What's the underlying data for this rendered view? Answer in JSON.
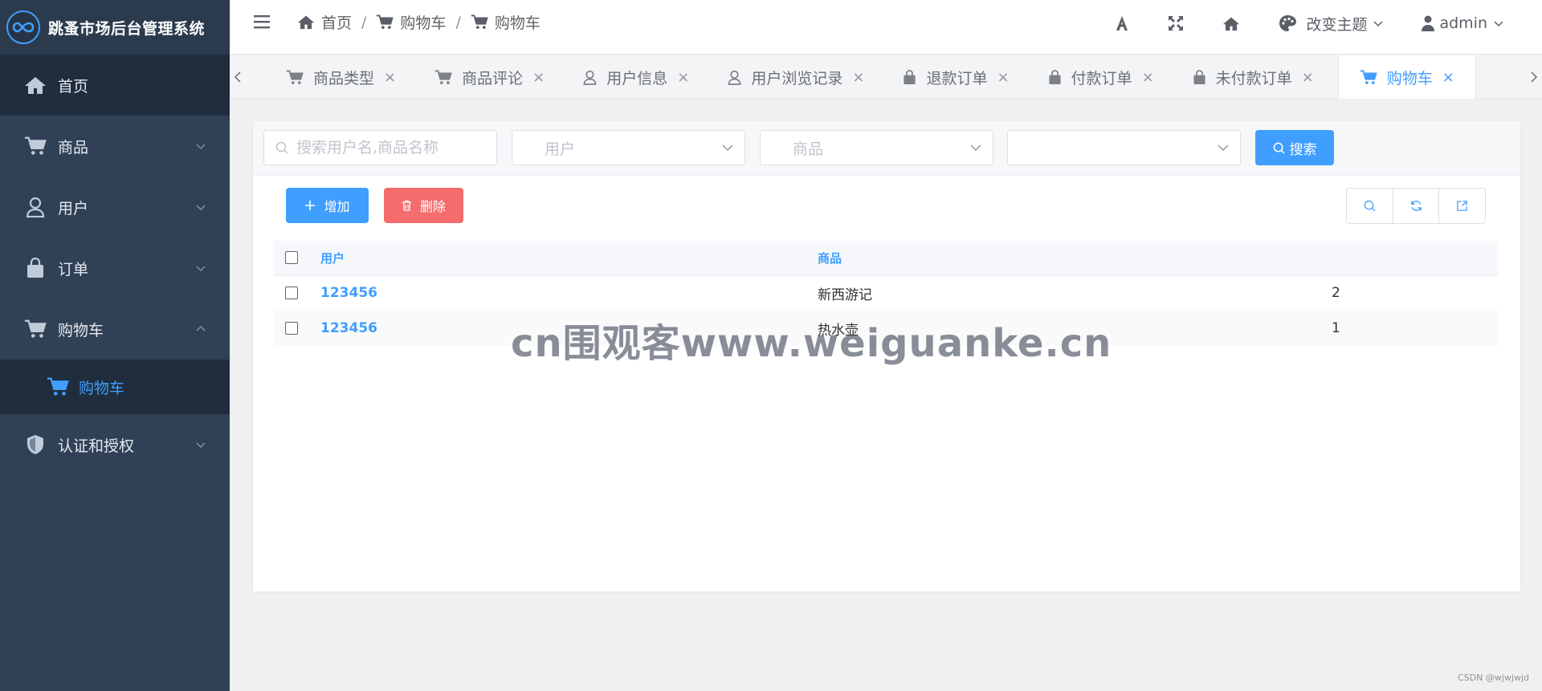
{
  "app": {
    "title": "跳蚤市场后台管理系统"
  },
  "sidebar": {
    "items": [
      {
        "label": "首页",
        "icon": "home-icon"
      },
      {
        "label": "商品",
        "icon": "cart-icon"
      },
      {
        "label": "用户",
        "icon": "user-icon"
      },
      {
        "label": "订单",
        "icon": "bag-icon"
      },
      {
        "label": "购物车",
        "icon": "cart-icon"
      },
      {
        "label": "认证和授权",
        "icon": "shield-icon"
      }
    ],
    "submenu": {
      "label": "购物车",
      "icon": "cart-icon"
    }
  },
  "breadcrumb": [
    "首页",
    "购物车",
    "购物车"
  ],
  "header": {
    "theme_label": "改变主题",
    "user_name": "admin"
  },
  "tabs": [
    {
      "label": "商品类型",
      "icon": "cart-icon"
    },
    {
      "label": "商品评论",
      "icon": "cart-icon"
    },
    {
      "label": "用户信息",
      "icon": "user-icon"
    },
    {
      "label": "用户浏览记录",
      "icon": "user-icon"
    },
    {
      "label": "退款订单",
      "icon": "bag-icon"
    },
    {
      "label": "付款订单",
      "icon": "bag-icon"
    },
    {
      "label": "未付款订单",
      "icon": "bag-icon"
    },
    {
      "label": "购物车",
      "icon": "cart-icon",
      "active": true
    }
  ],
  "tab_close_symbol": "×",
  "breadcrumb_separator": "/",
  "search": {
    "keyword_placeholder": "搜索用户名,商品名称",
    "user_placeholder": "用户",
    "product_placeholder": "商品",
    "button_label": "搜索"
  },
  "toolbar": {
    "add_label": "增加",
    "delete_label": "删除"
  },
  "table": {
    "columns": [
      "用户",
      "商品"
    ],
    "rows": [
      {
        "user": "123456",
        "product": "新西游记",
        "quantity": "2"
      },
      {
        "user": "123456",
        "product": "热水壶",
        "quantity": "1"
      }
    ]
  },
  "watermark": "cn围观客www.weiguanke.cn",
  "credit": "CSDN @wjwjwjd",
  "colors": {
    "primary": "#409eff",
    "danger": "#f56c6c",
    "sidebar": "#304156"
  }
}
